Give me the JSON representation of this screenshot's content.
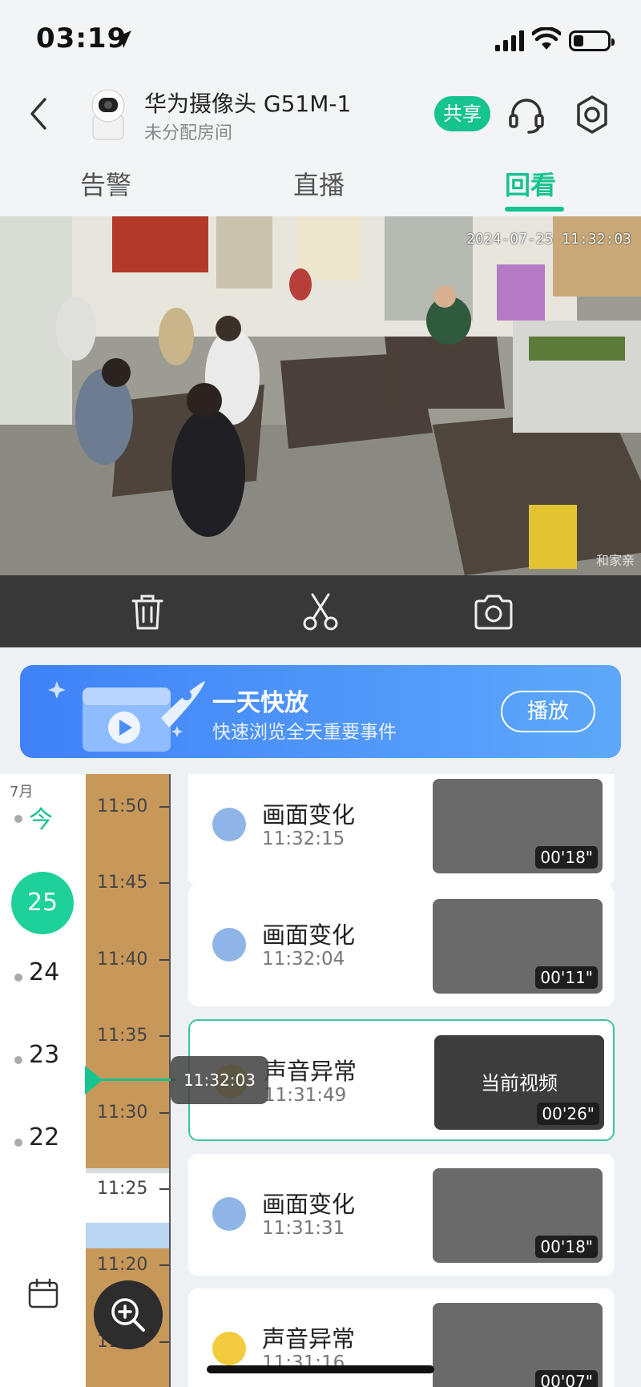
{
  "status": {
    "time": "03:19"
  },
  "header": {
    "device_name": "华为摄像头 G51M-1",
    "room": "未分配房间",
    "share_label": "共享",
    "accent_color": "#17c38f"
  },
  "tabs": [
    {
      "label": "告警",
      "active": false
    },
    {
      "label": "直播",
      "active": false
    },
    {
      "label": "回看",
      "active": true
    }
  ],
  "video": {
    "timestamp": "2024-07-25 11:32:03",
    "watermark": "和家亲"
  },
  "controls": [
    "trash-icon",
    "scissors-icon",
    "camera-icon"
  ],
  "banner": {
    "title": "一天快放",
    "subtitle": "快速浏览全天重要事件",
    "button": "播放"
  },
  "dates": {
    "month": "7月",
    "today": "今",
    "selected": "25",
    "days": [
      "24",
      "23",
      "22"
    ]
  },
  "timeline": {
    "labels": [
      "11:50",
      "11:45",
      "11:40",
      "11:35",
      "11:30",
      "11:25",
      "11:20",
      "11:15"
    ],
    "cursor_time": "11:32:03"
  },
  "events": [
    {
      "type": "画面变化",
      "time": "11:32:15",
      "duration": "00'18\"",
      "icon": "blue",
      "current": false
    },
    {
      "type": "画面变化",
      "time": "11:32:04",
      "duration": "00'11\"",
      "icon": "blue",
      "current": false
    },
    {
      "type": "声音异常",
      "time": "11:31:49",
      "duration": "00'26\"",
      "icon": "yellow",
      "current": true,
      "current_label": "当前视频"
    },
    {
      "type": "画面变化",
      "time": "11:31:31",
      "duration": "00'18\"",
      "icon": "blue",
      "current": false
    },
    {
      "type": "声音异常",
      "time": "11:31:16",
      "duration": "00'07\"",
      "icon": "yellow",
      "current": false
    }
  ]
}
